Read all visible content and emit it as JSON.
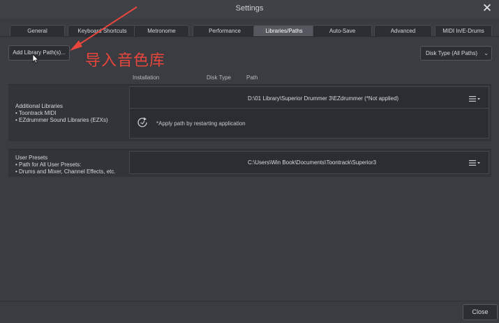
{
  "window": {
    "title": "Settings"
  },
  "tabs": [
    {
      "label": "General",
      "active": false
    },
    {
      "label": "Keyboard Shortcuts",
      "active": false
    },
    {
      "label": "Metronome",
      "active": false
    },
    {
      "label": "Performance",
      "active": false
    },
    {
      "label": "Libraries/Paths",
      "active": true
    },
    {
      "label": "Auto-Save",
      "active": false
    },
    {
      "label": "Advanced",
      "active": false
    },
    {
      "label": "MIDI In/E-Drums",
      "active": false
    }
  ],
  "toolbar": {
    "add_library_label": "Add Library Path(s)...",
    "disk_type_label": "Disk Type (All Paths)",
    "annotation": "导入音色库"
  },
  "columns": {
    "installation": "Installation",
    "disk_type": "Disk Type",
    "path": "Path"
  },
  "additional_libraries": {
    "lines": [
      "Additional Libraries",
      "• Toontrack MIDI",
      "• EZdrummer Sound Libraries (EZXs)"
    ],
    "path": "D:\\01 Library\\Superior Drummer 3\\EZdrummer (*Not applied)",
    "apply_note": "*Apply path by restarting application"
  },
  "user_presets": {
    "lines": [
      "User Presets",
      "• Path for All User Presets:",
      "• Drums and Mixer, Channel Effects, etc."
    ],
    "path": "C:\\Users\\Win Book\\Documents\\Toontrack\\Superior3"
  },
  "footer": {
    "close_label": "Close"
  },
  "colors": {
    "annotation": "#e8463c",
    "background": "#3a3c41",
    "active_tab": "#55585f"
  },
  "icons": [
    "close-icon",
    "hamburger-menu-icon",
    "refresh-icon",
    "cursor-pointer-icon",
    "chevron-down-icon"
  ]
}
